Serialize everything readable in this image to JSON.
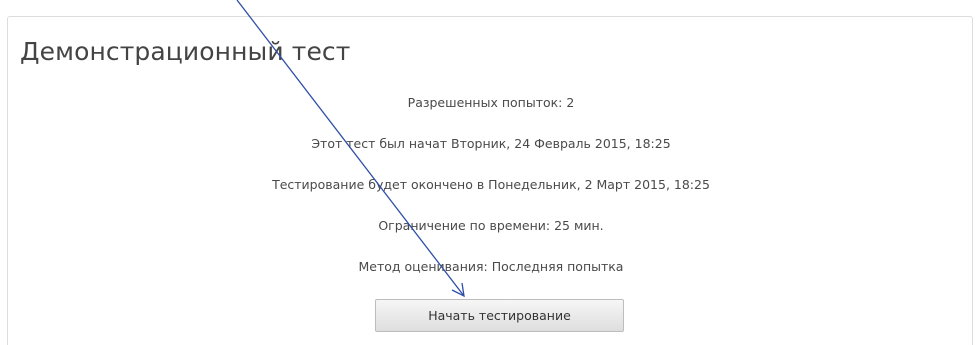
{
  "test": {
    "title": "Демонстрационный тест",
    "attempts_allowed": "Разрешенных попыток: 2",
    "started_at": "Этот тест был начат Вторник, 24 Февраль 2015, 18:25",
    "ends_at": "Тестирование будет окончено в Понедельник, 2 Март 2015, 18:25",
    "time_limit": "Ограничение по времени: 25 мин.",
    "grading_method": "Метод оценивания: Последняя попытка",
    "start_button_label": "Начать тестирование"
  },
  "annotation": {
    "arrow_color": "#2e4fa8"
  }
}
